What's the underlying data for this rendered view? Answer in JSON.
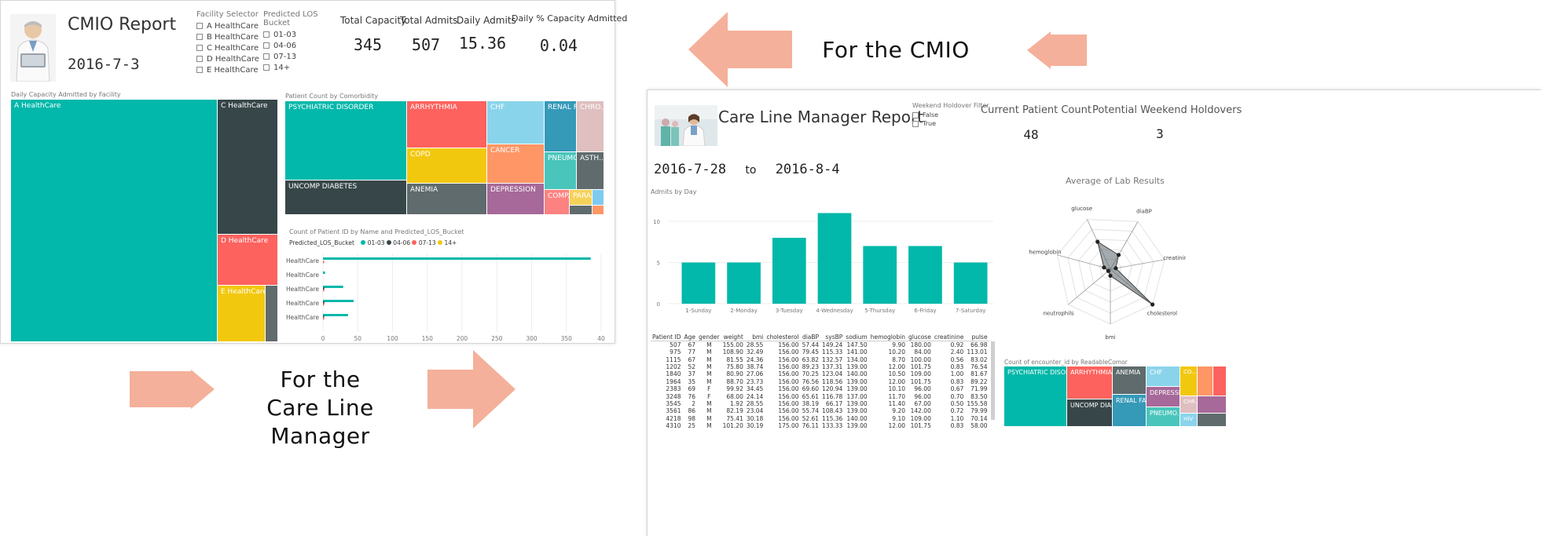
{
  "cmio": {
    "title": "CMIO Report",
    "date": "2016-7-3",
    "facility_selector": {
      "label": "Facility Selector",
      "options": [
        "A HealthCare",
        "B HealthCare",
        "C HealthCare",
        "D HealthCare",
        "E HealthCare"
      ]
    },
    "los_bucket": {
      "label": "Predicted LOS Bucket",
      "options": [
        "01-03",
        "04-06",
        "07-13",
        "14+"
      ]
    },
    "kpis": [
      {
        "label": "Total Capacity",
        "value": "345"
      },
      {
        "label": "Total Admits",
        "value": "507"
      },
      {
        "label": "Daily Admits",
        "value": "15.36"
      },
      {
        "label": "Daily % Capacity Admitted",
        "value": "0.04"
      }
    ],
    "capacity_treemap": {
      "title": "Daily Capacity Admitted by Facility",
      "tiles": [
        "A HealthCare",
        "C HealthCare",
        "D HealthCare",
        "E HealthCare"
      ]
    },
    "comorbidity_treemap": {
      "title": "Patient Count by Comorbidity",
      "tiles": [
        "PSYCHIATRIC DISORDER",
        "ARRHYTHMIA",
        "CHF",
        "RENAL F...",
        "CHRO...",
        "COPD",
        "CANCER",
        "PNEUMO...",
        "ASTH...",
        "UNCOMP DIABETES",
        "ANEMIA",
        "DEPRESSION",
        "COMP...",
        "PARA..."
      ]
    },
    "bar_chart": {
      "title": "Count of Patient ID by Name and Predicted_LOS_Bucket",
      "legend_title": "Predicted_LOS_Bucket",
      "legend": [
        {
          "name": "01-03",
          "color": "#01b8aa"
        },
        {
          "name": "04-06",
          "color": "#374649"
        },
        {
          "name": "07-13",
          "color": "#fd625e"
        },
        {
          "name": "14+",
          "color": "#f2c80f"
        }
      ],
      "categories": [
        "A HealthCare",
        "B HealthCare",
        "C HealthCare",
        "D HealthCare",
        "E HealthCare"
      ],
      "values_0103": [
        385,
        3,
        29,
        44,
        36
      ],
      "values_0406": [
        0,
        0,
        2,
        2,
        1
      ],
      "values_0713": [
        1,
        0,
        1,
        1,
        1
      ],
      "values_14": [
        0,
        0,
        0,
        0,
        0
      ],
      "ticks": [
        "0",
        "50",
        "100",
        "150",
        "200",
        "250",
        "300",
        "350",
        "40"
      ]
    }
  },
  "callouts": {
    "cmio": "For the CMIO",
    "clm_line1": "For the",
    "clm_line2": "Care Line Manager"
  },
  "clm": {
    "title": "Care Line Manager Report",
    "weekend_filter": {
      "label": "Weekend Holdover Filter",
      "options": [
        "False",
        "True"
      ]
    },
    "kpis": [
      {
        "label": "Current Patient Count",
        "value": "48"
      },
      {
        "label": "Potential Weekend Holdovers",
        "value": "3"
      }
    ],
    "date_from": "2016-7-28",
    "date_to_word": "to",
    "date_to": "2016-8-4",
    "chart_data": {
      "type": "bar",
      "title": "Admits by Day",
      "categories": [
        "1-Sunday",
        "2-Monday",
        "3-Tuesday",
        "4-Wednesday",
        "5-Thursday",
        "6-Friday",
        "7-Saturday"
      ],
      "values": [
        5,
        5,
        8,
        11,
        7,
        7,
        5
      ],
      "yticks": [
        "0",
        "5",
        "10"
      ],
      "ylim": [
        0,
        12
      ],
      "color": "#01b8aa"
    },
    "radar": {
      "title": "Average of Lab Results",
      "axes": [
        "diaBP",
        "creatinine",
        "cholesterol",
        "bmi",
        "neutrophils",
        "hemoglobin",
        "glucose"
      ]
    },
    "table": {
      "headers": [
        "Patient ID",
        "Age",
        "gender",
        "weight",
        "bmi",
        "cholesterol",
        "diaBP",
        "sysBP",
        "sodium",
        "hemoglobin",
        "glucose",
        "creatinine",
        "pulse"
      ],
      "rows": [
        [
          "507",
          "67",
          "M",
          "155.00",
          "28.55",
          "156.00",
          "57.44",
          "149.24",
          "147.50",
          "9.90",
          "180.00",
          "0.92",
          "66.98"
        ],
        [
          "975",
          "77",
          "M",
          "108.90",
          "32.49",
          "156.00",
          "79.45",
          "115.33",
          "141.00",
          "10.20",
          "84.00",
          "2.40",
          "113.01"
        ],
        [
          "1115",
          "67",
          "M",
          "81.55",
          "24.36",
          "156.00",
          "63.82",
          "132.57",
          "134.00",
          "8.70",
          "100.00",
          "0.56",
          "83.02"
        ],
        [
          "1202",
          "52",
          "M",
          "75.80",
          "38.74",
          "156.00",
          "89.23",
          "137.31",
          "139.00",
          "12.00",
          "101.75",
          "0.83",
          "76.54"
        ],
        [
          "1840",
          "37",
          "M",
          "80.90",
          "27.06",
          "156.00",
          "70.25",
          "123.04",
          "140.00",
          "10.50",
          "109.00",
          "1.00",
          "81.67"
        ],
        [
          "1964",
          "35",
          "M",
          "88.70",
          "23.73",
          "156.00",
          "76.56",
          "118.56",
          "139.00",
          "12.00",
          "101.75",
          "0.83",
          "89.22"
        ],
        [
          "2383",
          "69",
          "F",
          "99.92",
          "34.45",
          "156.00",
          "69.60",
          "120.94",
          "139.00",
          "10.10",
          "96.00",
          "0.67",
          "71.99"
        ],
        [
          "3248",
          "76",
          "F",
          "68.00",
          "24.14",
          "156.00",
          "65.61",
          "116.78",
          "137.00",
          "11.70",
          "96.00",
          "0.70",
          "83.50"
        ],
        [
          "3545",
          "2",
          "M",
          "1.92",
          "28.55",
          "156.00",
          "38.19",
          "66.17",
          "139.00",
          "11.40",
          "67.00",
          "0.50",
          "155.58"
        ],
        [
          "3561",
          "86",
          "M",
          "82.19",
          "23.04",
          "156.00",
          "55.74",
          "108.43",
          "139.00",
          "9.20",
          "142.00",
          "0.72",
          "79.99"
        ],
        [
          "4218",
          "98",
          "M",
          "75.41",
          "30.18",
          "156.00",
          "52.61",
          "115.36",
          "140.00",
          "9.10",
          "109.00",
          "1.10",
          "70.14"
        ],
        [
          "4310",
          "25",
          "M",
          "101.20",
          "30.19",
          "175.00",
          "76.11",
          "133.33",
          "139.00",
          "12.00",
          "101.75",
          "0.83",
          "58.00"
        ]
      ]
    },
    "comor_treemap": {
      "title": "Count of encounter_id by ReadableComor",
      "tiles": [
        "PSYCHIATRIC DISORD...",
        "ARRHYTHMIA",
        "ANEMIA",
        "CHF",
        "CO...",
        "UNCOMP DIAB...",
        "RENAL FAIL",
        "DEPRESSI...",
        "CHR...",
        "PNEUMO...",
        "HIV"
      ]
    }
  },
  "colors": {
    "teal": "#01b8aa",
    "dark": "#374649",
    "red": "#fd625e",
    "yellow": "#f2c80f",
    "grey": "#5f6b6d",
    "skyblue": "#8ad4eb",
    "orange": "#fe9666",
    "purple": "#a66999",
    "steel": "#3599b8",
    "pink": "#dfbfbf",
    "mint": "#4ac5bb",
    "arrow": "#f4b09a"
  }
}
